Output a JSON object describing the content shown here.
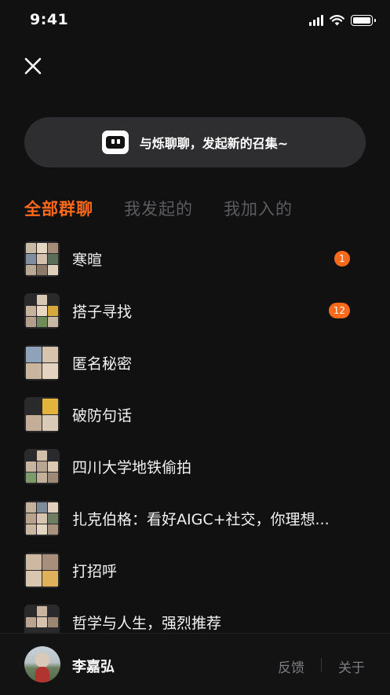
{
  "status_bar": {
    "time": "9:41"
  },
  "banner": {
    "text": "与烁聊聊，发起新的召集~"
  },
  "tabs": [
    {
      "label": "全部群聊",
      "active": true
    },
    {
      "label": "我发起的",
      "active": false
    },
    {
      "label": "我加入的",
      "active": false
    }
  ],
  "groups": [
    {
      "name": "寒暄",
      "unread": "1"
    },
    {
      "name": "搭子寻找",
      "unread": "12"
    },
    {
      "name": "匿名秘密",
      "unread": ""
    },
    {
      "name": "破防句话",
      "unread": ""
    },
    {
      "name": "四川大学地铁偷拍",
      "unread": ""
    },
    {
      "name": "扎克伯格：看好AIGC+社交，你理想...",
      "unread": ""
    },
    {
      "name": "打招呼",
      "unread": ""
    },
    {
      "name": "哲学与人生，强烈推荐",
      "unread": ""
    }
  ],
  "footer": {
    "user_name": "李嘉弘",
    "feedback_label": "反馈",
    "about_label": "关于"
  },
  "colors": {
    "accent": "#ff6a1a",
    "background": "#111112",
    "banner_bg": "#2e2e30"
  }
}
